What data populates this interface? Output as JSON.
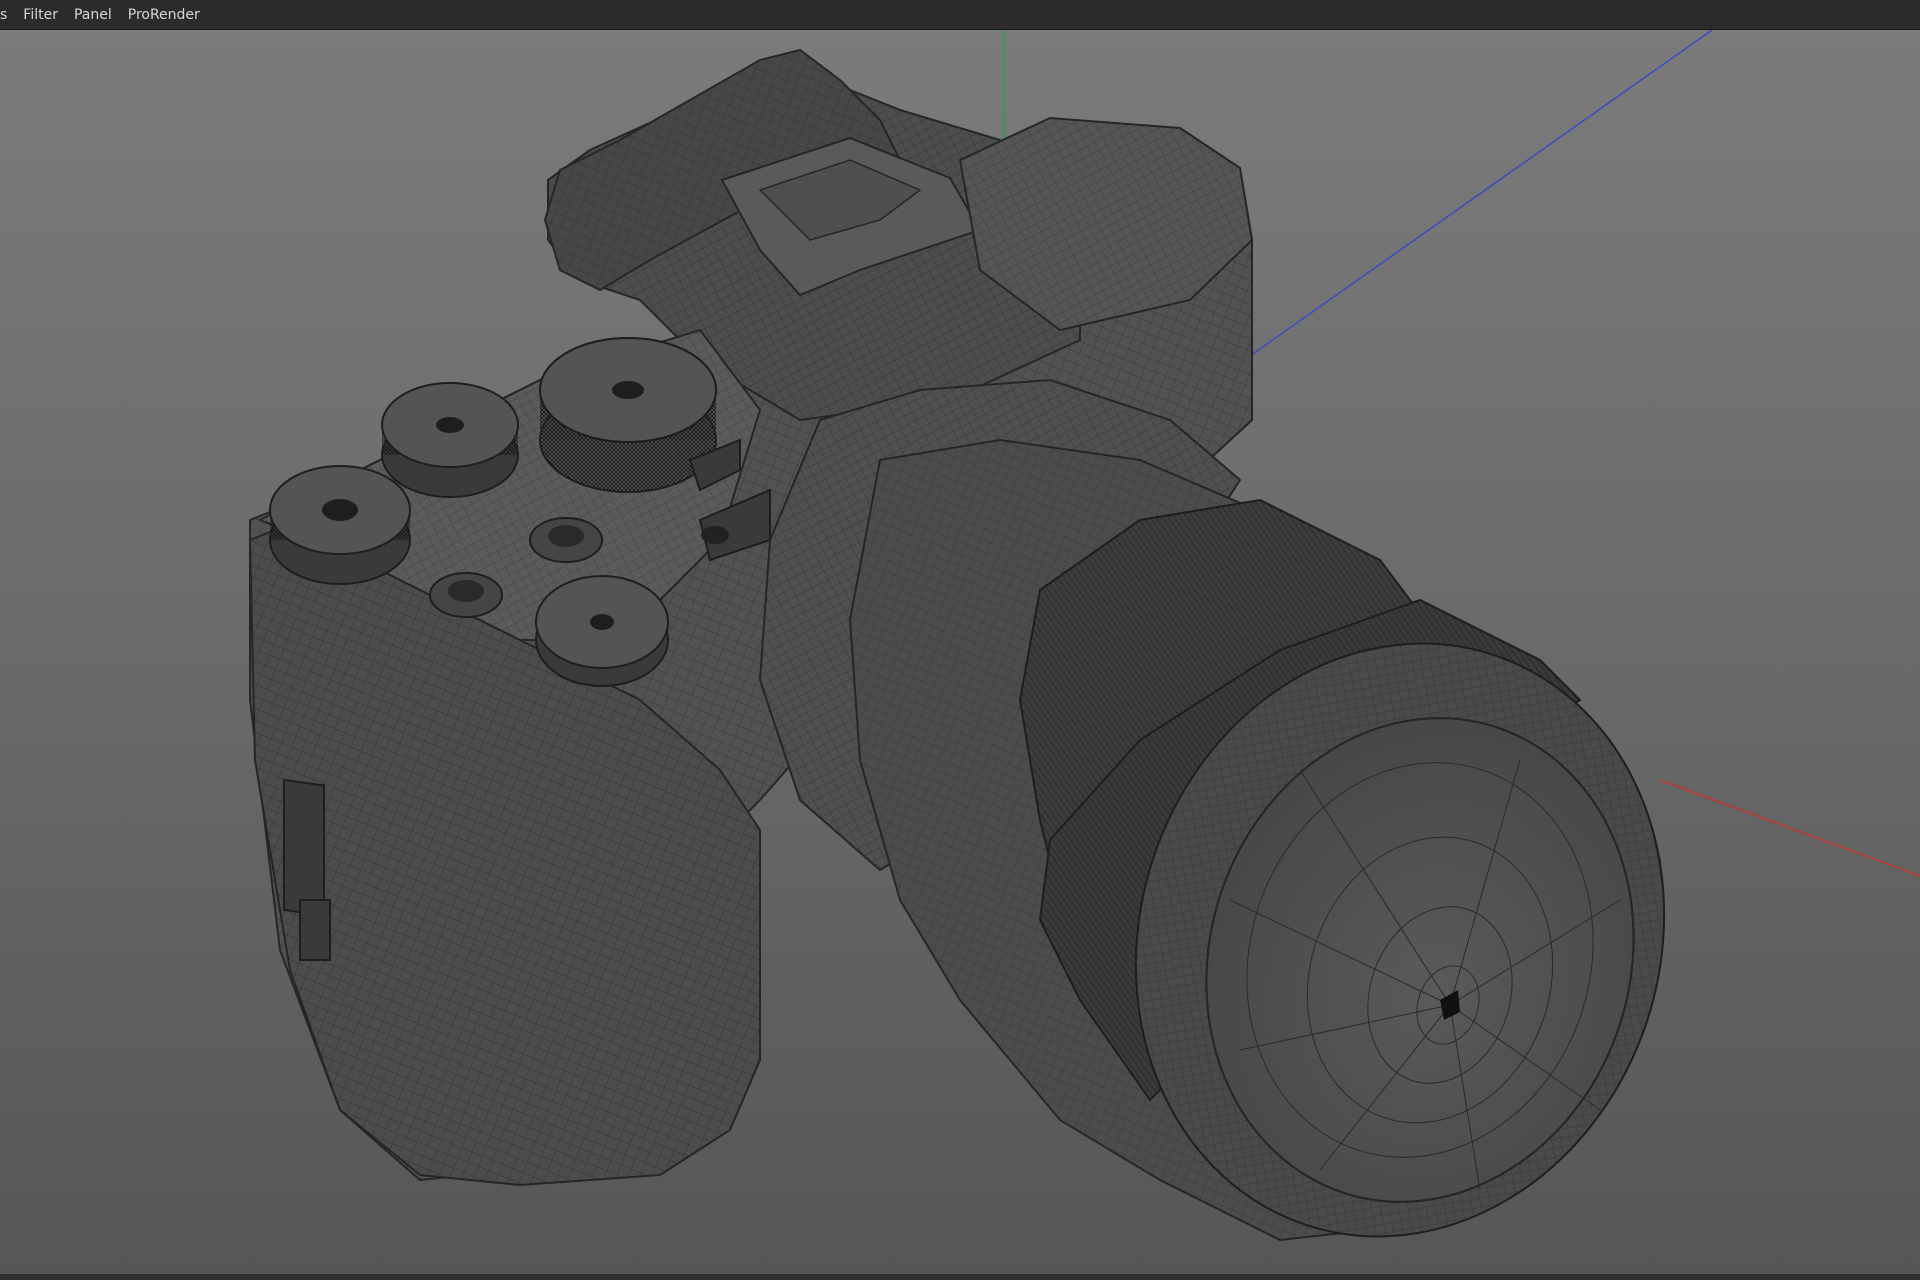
{
  "menubar": {
    "items": [
      {
        "label": "s",
        "name": "menu-truncated"
      },
      {
        "label": "Filter",
        "name": "menu-filter"
      },
      {
        "label": "Panel",
        "name": "menu-panel"
      },
      {
        "label": "ProRender",
        "name": "menu-prorender"
      }
    ]
  },
  "viewport": {
    "display_mode": "wireframe",
    "model": "camera-with-lens",
    "colors": {
      "background_top": "#7b7b7b",
      "background_bottom": "#565656",
      "model_fill": "#505050",
      "wire": "#262626",
      "axis_x": "#c0392b",
      "axis_y": "#2ea043",
      "axis_z": "#3b4cc0"
    }
  }
}
